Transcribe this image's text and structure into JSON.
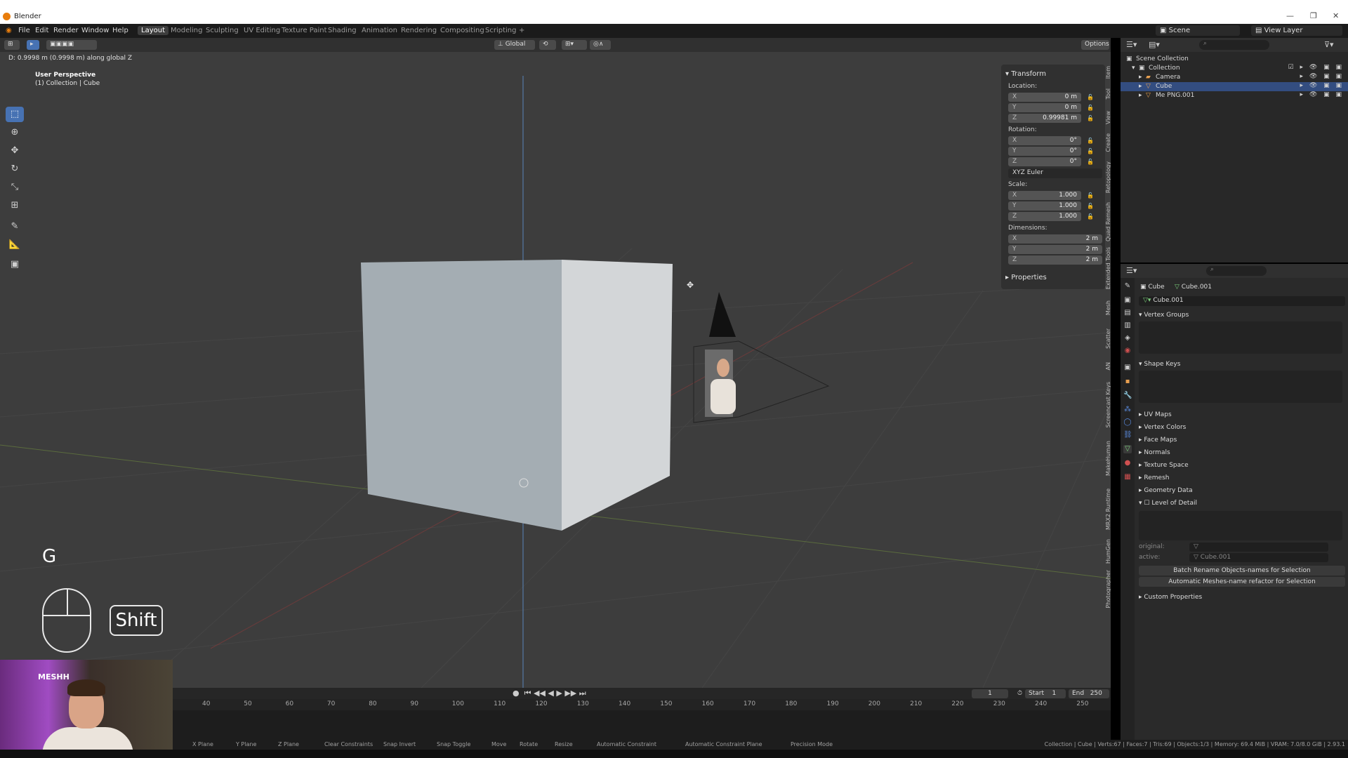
{
  "window": {
    "title": "Blender",
    "controls": [
      "—",
      "❐",
      "✕"
    ]
  },
  "menu": {
    "items": [
      "File",
      "Edit",
      "Render",
      "Window",
      "Help"
    ],
    "workspaces": [
      "Layout",
      "Modeling",
      "Sculpting",
      "UV Editing",
      "Texture Paint",
      "Shading",
      "Animation",
      "Rendering",
      "Compositing",
      "Scripting",
      "+"
    ],
    "active_workspace": "Layout",
    "scene": "Scene",
    "view_layer": "View Layer"
  },
  "viewport": {
    "header": {
      "orientation": "Global",
      "options": "Options"
    },
    "status_message": "D: 0.9998 m (0.9998 m) along global Z",
    "perspective_label": "User Perspective",
    "collection_label": "(1) Collection | Cube"
  },
  "tools": [
    "select-box",
    "cursor",
    "move",
    "rotate",
    "scale",
    "transform",
    "annotate",
    "measure",
    "add-cube"
  ],
  "n_panel": {
    "title": "Transform",
    "location_label": "Location:",
    "location": {
      "x": "0 m",
      "y": "0 m",
      "z": "0.99981 m"
    },
    "rotation_label": "Rotation:",
    "rotation": {
      "x": "0°",
      "y": "0°",
      "z": "0°"
    },
    "rotation_mode": "XYZ Euler",
    "scale_label": "Scale:",
    "scale": {
      "x": "1.000",
      "y": "1.000",
      "z": "1.000"
    },
    "dimensions_label": "Dimensions:",
    "dimensions": {
      "x": "2 m",
      "y": "2 m",
      "z": "2 m"
    },
    "properties_label": "Properties",
    "axes": {
      "x": "X",
      "y": "Y",
      "z": "Z"
    }
  },
  "sidebar_tabs": [
    "Item",
    "Tool",
    "View",
    "Create",
    "Retopology",
    "Quad Remesh",
    "Extended Tools",
    "Mesh",
    "Scatter",
    "AN",
    "Screencast Keys",
    "MakeHuman",
    "MRX2 Runtime",
    "HumGen",
    "Photographer"
  ],
  "keycast": {
    "key": "G",
    "modifier": "Shift"
  },
  "webcam": {
    "logo": "MESHH"
  },
  "timeline": {
    "ticks": [
      "40",
      "50",
      "60",
      "70",
      "80",
      "90",
      "100",
      "110",
      "120",
      "130",
      "140",
      "150",
      "160",
      "170",
      "180",
      "190",
      "200",
      "210",
      "220",
      "230",
      "240",
      "250"
    ],
    "current_frame": "1",
    "start_label": "Start",
    "start": "1",
    "end_label": "End",
    "end": "250"
  },
  "statusbar": {
    "hints": [
      "X Plane",
      "Y Plane",
      "Z Plane",
      "Clear Constraints",
      "Snap Invert",
      "Snap Toggle",
      "Move",
      "Rotate",
      "Resize",
      "Automatic Constraint",
      "Automatic Constraint Plane",
      "Precision Mode"
    ],
    "stats": "Collection | Cube | Verts:67 | Faces:7 | Tris:69 | Objects:1/3 | Memory: 69.4 MiB | VRAM: 7.0/8.0 GiB | 2.93.1"
  },
  "outliner": {
    "root": "Scene Collection",
    "collection": "Collection",
    "items": [
      {
        "name": "Camera",
        "selected": false
      },
      {
        "name": "Cube",
        "selected": true
      },
      {
        "name": "Me PNG.001",
        "selected": false
      }
    ]
  },
  "properties": {
    "object_name": "Cube",
    "mesh_name": "Cube.001",
    "data_name": "Cube.001",
    "sections": {
      "vertex_groups": "Vertex Groups",
      "shape_keys": "Shape Keys",
      "uv_maps": "UV Maps",
      "vertex_colors": "Vertex Colors",
      "face_maps": "Face Maps",
      "normals": "Normals",
      "texture_space": "Texture Space",
      "remesh": "Remesh",
      "geometry_data": "Geometry Data",
      "level_of_detail": "Level of Detail",
      "custom_properties": "Custom Properties"
    },
    "lod": {
      "original_label": "original:",
      "active_label": "active:",
      "active_value": "Cube.001"
    },
    "buttons": {
      "batch_rename": "Batch Rename Objects-names for Selection",
      "auto_meshes": "Automatic Meshes-name refactor for Selection"
    }
  },
  "colors": {
    "accent": "#4772b3",
    "selection": "#334d80",
    "viewport_bg": "#3d3d3d"
  }
}
